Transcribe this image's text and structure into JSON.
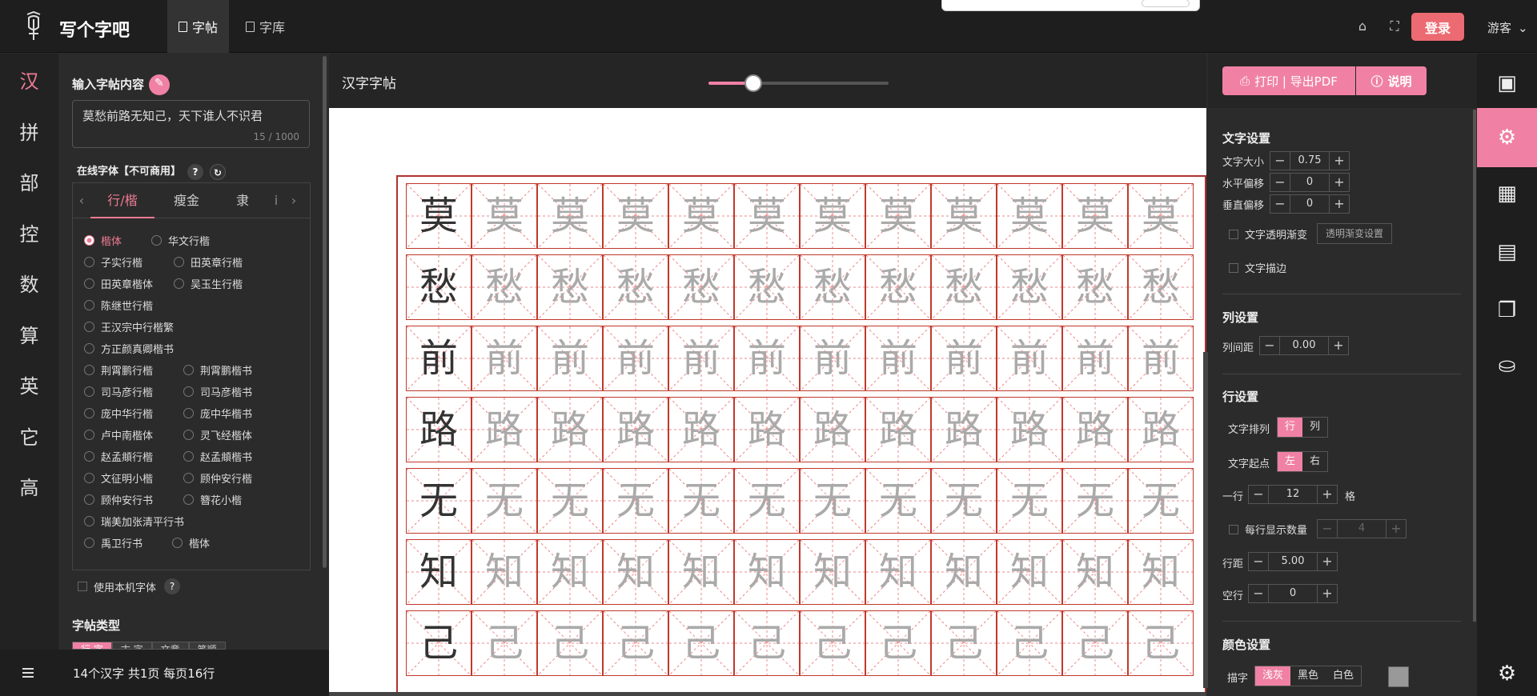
{
  "app": {
    "brand": "写个字吧",
    "nav": [
      {
        "label": "字帖"
      },
      {
        "label": "字库"
      }
    ],
    "login": "登录",
    "guest": "游客"
  },
  "rail": [
    "汉",
    "拼",
    "部",
    "控",
    "数",
    "算",
    "英",
    "它",
    "高"
  ],
  "input": {
    "title": "输入字帖内容",
    "text": "莫愁前路无知己，天下谁人不识君",
    "counter": "15 / 1000"
  },
  "font_section": {
    "title": "在线字体【不可商用】",
    "tabs": [
      "行/楷",
      "瘦金",
      "隶",
      "i"
    ],
    "options": [
      "楷体",
      "华文行楷",
      "子实行楷",
      "田英章行楷",
      "田英章楷体",
      "吴玉生行楷",
      "陈继世行楷",
      "王汉宗中行楷繁",
      "方正颜真卿楷书",
      "荆霄鹏行楷",
      "荆霄鹏楷书",
      "司马彦行楷",
      "司马彦楷书",
      "庞中华行楷",
      "庞中华楷书",
      "卢中南楷体",
      "灵飞经楷体",
      "赵孟頫行楷",
      "赵孟頫楷书",
      "文征明小楷",
      "顾仲安行楷",
      "顾仲安行书",
      "簪花小楷",
      "瑞美加张清平行书",
      "禹卫行书",
      "楷体"
    ],
    "selected": "楷体",
    "local_font": "使用本机字体"
  },
  "type_section": {
    "title": "字帖类型",
    "tabs": [
      "行 字",
      "古 字",
      "文章",
      "笔顺"
    ]
  },
  "status": "14个汉字 共1页 每页16行",
  "center": {
    "title": "汉字字帖",
    "zoom_level": 0.25
  },
  "sheet": {
    "rows": [
      "莫",
      "愁",
      "前",
      "路",
      "无",
      "知",
      "己"
    ],
    "cols": 12
  },
  "toolbar": {
    "print": "打印 | 导出PDF",
    "help": "说明"
  },
  "text_settings": {
    "title": "文字设置",
    "size_label": "文字大小",
    "size": "0.75",
    "hoff_label": "水平偏移",
    "hoff": "0",
    "voff_label": "垂直偏移",
    "voff": "0",
    "gradient_label": "文字透明渐变",
    "gradient_btn": "透明渐变设置",
    "stroke_label": "文字描边"
  },
  "col_settings": {
    "title": "列设置",
    "gap_label": "列间距",
    "gap": "0.00"
  },
  "row_settings": {
    "title": "行设置",
    "arrange_label": "文字排列",
    "arrange": [
      "行",
      "列"
    ],
    "start_label": "文字起点",
    "start": [
      "左",
      "右"
    ],
    "per_line_label": "一行",
    "per_line": "12",
    "per_line_unit": "格",
    "show_count_label": "每行显示数量",
    "show_count": "4",
    "line_spacing_label": "行距",
    "line_spacing": "5.00",
    "blank_label": "空行",
    "blank": "0"
  },
  "color_settings": {
    "title": "颜色设置",
    "trace_label": "描字",
    "options": [
      "浅灰",
      "黑色",
      "白色"
    ]
  },
  "colors": {
    "accent": "#f081a5",
    "login": "#ec6a71",
    "grid": "#c0392b"
  }
}
